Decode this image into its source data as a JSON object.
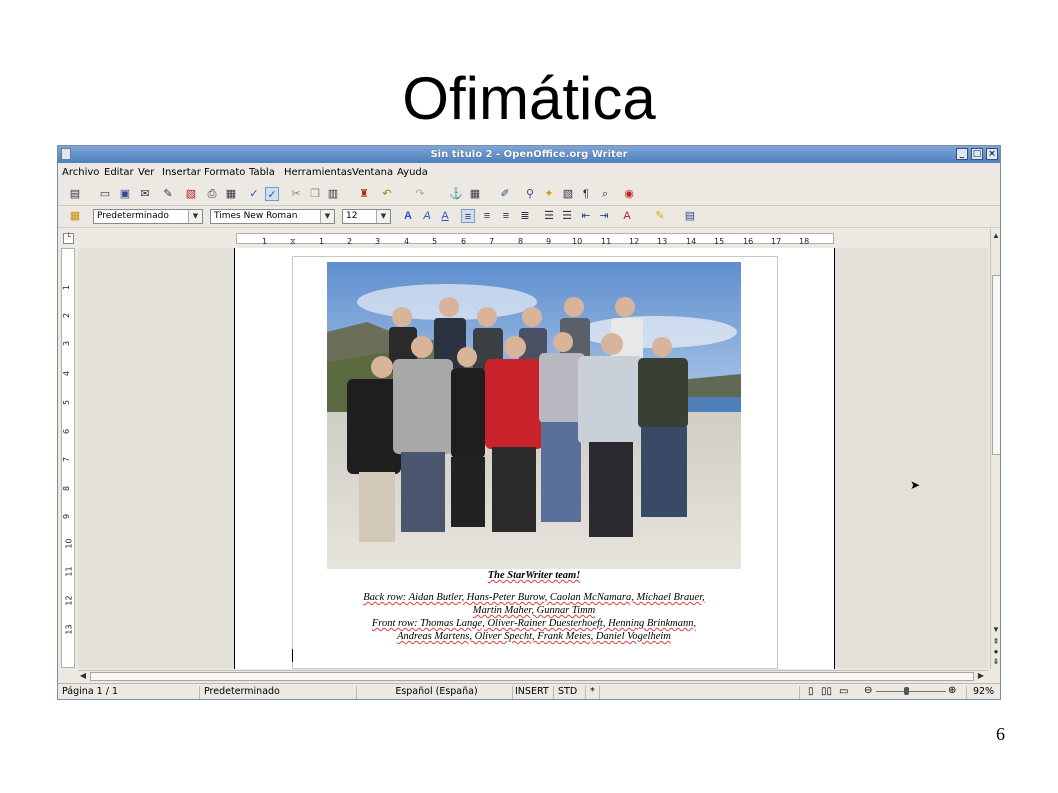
{
  "slide": {
    "title": "Ofimática",
    "number": "6"
  },
  "window": {
    "title": "Sin título 2 - OpenOffice.org Writer",
    "controls": {
      "minimize": "_",
      "maximize": "□",
      "close": "×"
    }
  },
  "menu": {
    "items": [
      "Archivo",
      "Editar",
      "Ver",
      "Insertar",
      "Formato",
      "Tabla",
      "Herramientas",
      "Ventana",
      "Ayuda"
    ]
  },
  "formatting": {
    "style": "Predeterminado",
    "font": "Times New Roman",
    "size": "12"
  },
  "ruler": {
    "marks": [
      "1",
      "1",
      "2",
      "3",
      "4",
      "5",
      "6",
      "7",
      "8",
      "9",
      "10",
      "11",
      "12",
      "13",
      "14",
      "15",
      "16",
      "17",
      "18"
    ]
  },
  "vruler": {
    "marks": [
      "1",
      "2",
      "3",
      "4",
      "5",
      "6",
      "7",
      "8",
      "9",
      "10",
      "11",
      "12",
      "13"
    ]
  },
  "document": {
    "caption_title": "The StarWriter team!",
    "caption_lines": [
      "Back row: Aidan Butler, Hans-Peter Burow, Caolan McNamara, Michael Brauer,",
      "Martin Maher, Gunnar Timm",
      "Front row: Thomas Lange, Oliver-Rainer Duesterhoeft, Henning Brinkmann,",
      "Andreas Martens, Oliver Specht, Frank Meies, Daniel Vogelheim"
    ]
  },
  "statusbar": {
    "page": "Página  1 / 1",
    "style": "Predeterminado",
    "language": "Español (España)",
    "insert": "INSERT",
    "selection": "STD",
    "modified": "*",
    "zoom": "92%"
  },
  "colors": {
    "titlebar": "#5d8bc8",
    "window_bg": "#ece9e2",
    "spell_underline": "#e04040"
  }
}
